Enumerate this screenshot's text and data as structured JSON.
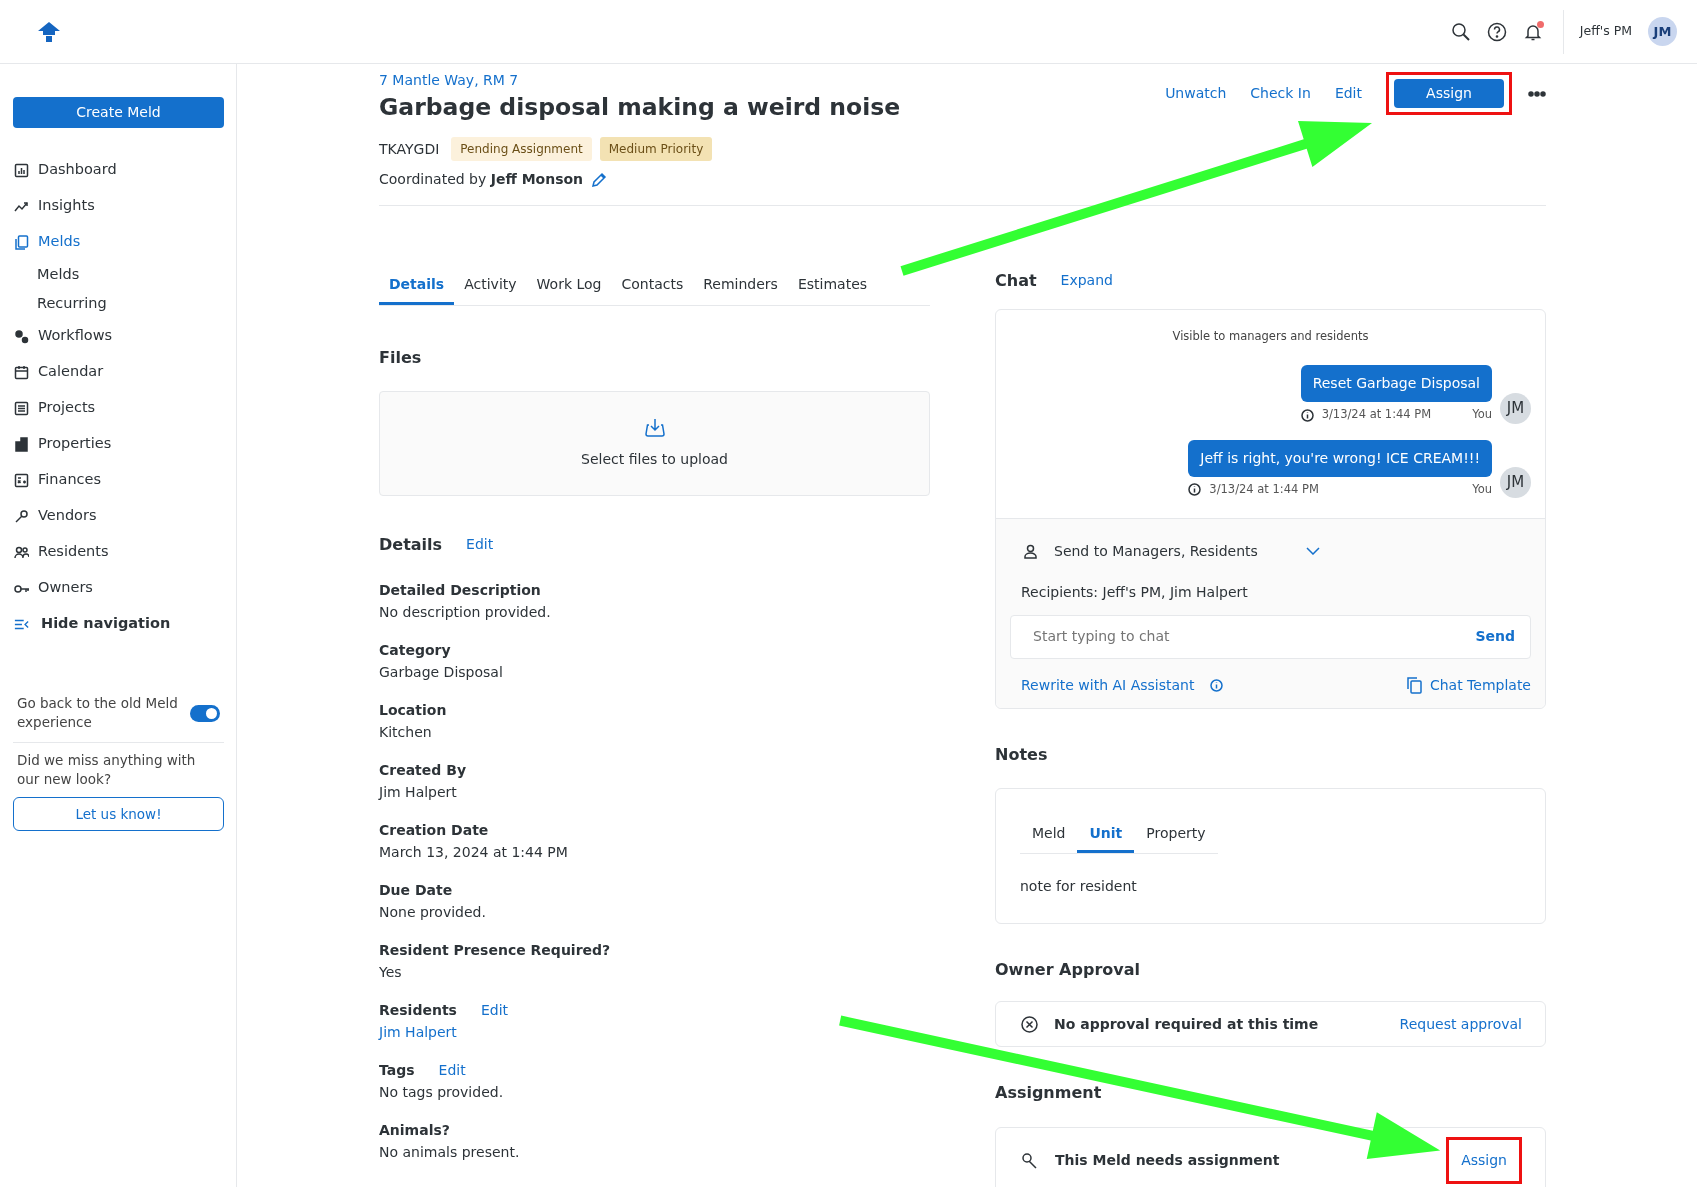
{
  "header": {
    "account": "Jeff's PM",
    "avatar": "JM",
    "notification_dot": true
  },
  "sidebar": {
    "create_button": "Create Meld",
    "items": [
      {
        "label": "Dashboard",
        "selected": false
      },
      {
        "label": "Insights",
        "selected": false
      },
      {
        "label": "Melds",
        "selected": true,
        "children": [
          {
            "label": "Melds",
            "selected": false
          },
          {
            "label": "Recurring",
            "selected": false
          }
        ]
      },
      {
        "label": "Workflows",
        "selected": false
      },
      {
        "label": "Calendar",
        "selected": false
      },
      {
        "label": "Projects",
        "selected": false
      },
      {
        "label": "Properties",
        "selected": false
      },
      {
        "label": "Finances",
        "selected": false
      },
      {
        "label": "Vendors",
        "selected": false
      },
      {
        "label": "Residents",
        "selected": false
      },
      {
        "label": "Owners",
        "selected": false
      }
    ],
    "hide_navigation": "Hide navigation",
    "old_experience": {
      "label": "Go back to the old Meld experience",
      "on": true
    },
    "feedback": {
      "prompt": "Did we miss anything with our new look?",
      "button": "Let us know!"
    }
  },
  "meld": {
    "address": "7 Mantle Way, RM 7",
    "title": "Garbage disposal making a weird noise",
    "actions": [
      {
        "label": "Unwatch",
        "kind": "link",
        "highlighted": false
      },
      {
        "label": "Check In",
        "kind": "link",
        "highlighted": false
      },
      {
        "label": "Edit",
        "kind": "link",
        "highlighted": false
      },
      {
        "label": "Assign",
        "kind": "primary",
        "highlighted": true
      }
    ],
    "code": "TKAYGDI",
    "badges": [
      {
        "label": "Pending Assignment",
        "color": "#fcf1dc"
      },
      {
        "label": "Medium Priority",
        "color": "#f3e2b3"
      }
    ],
    "coordinated_by": "Coordinated by **Jeff Monson**",
    "tabs": [
      {
        "label": "Details",
        "selected": true
      },
      {
        "label": "Activity",
        "selected": false
      },
      {
        "label": "Work Log",
        "selected": false
      },
      {
        "label": "Contacts",
        "selected": false
      },
      {
        "label": "Reminders",
        "selected": false
      },
      {
        "label": "Estimates",
        "selected": false
      }
    ],
    "files": {
      "title": "Files",
      "upload": "Select files to upload"
    },
    "details": {
      "title": "Details",
      "edit": "Edit",
      "fields": [
        {
          "label": "Detailed Description",
          "value": "No description provided.",
          "kind": "text"
        },
        {
          "label": "Category",
          "value": "Garbage Disposal",
          "kind": "text"
        },
        {
          "label": "Location",
          "value": "Kitchen",
          "kind": "text"
        },
        {
          "label": "Created By",
          "value": "Jim Halpert",
          "kind": "text"
        },
        {
          "label": "Creation Date",
          "value": "March 13, 2024 at 1:44 PM",
          "kind": "text"
        },
        {
          "label": "Due Date",
          "value": "None provided.",
          "kind": "text"
        },
        {
          "label": "Resident Presence Required?",
          "value": "Yes",
          "kind": "text"
        },
        {
          "label": "Residents",
          "edit": "Edit",
          "value": "Jim Halpert",
          "kind": "link"
        },
        {
          "label": "Tags",
          "edit": "Edit",
          "value": "No tags provided.",
          "kind": "text"
        },
        {
          "label": "Animals?",
          "value": "No animals present.",
          "kind": "text"
        }
      ]
    }
  },
  "chat": {
    "title": "Chat",
    "expand": "Expand",
    "visibility": "Visible to managers and residents",
    "messages": [
      {
        "text": "Reset Garbage Disposal",
        "time": "3/13/24 at 1:44 PM",
        "sender": "You",
        "avatar": "JM"
      },
      {
        "text": "Jeff is right, you're wrong! ICE CREAM!!!",
        "time": "3/13/24 at 1:44 PM",
        "sender": "You",
        "avatar": "JM"
      }
    ],
    "send_to": "Send to Managers, Residents",
    "recipients": "Recipients: Jeff's PM, Jim Halpert",
    "input": {
      "placeholder": "Start typing to chat"
    },
    "send": "Send",
    "rewrite": "Rewrite with AI Assistant",
    "template": "Chat Template"
  },
  "notes": {
    "title": "Notes",
    "tabs": [
      {
        "label": "Meld",
        "selected": false
      },
      {
        "label": "Unit",
        "selected": true
      },
      {
        "label": "Property",
        "selected": false
      }
    ],
    "text": "note for resident"
  },
  "owner_approval": {
    "title": "Owner Approval",
    "status": "No approval required at this time",
    "action": "Request approval"
  },
  "assignment": {
    "title": "Assignment",
    "status": "This Meld needs assignment",
    "action": "Assign",
    "highlighted": true
  }
}
